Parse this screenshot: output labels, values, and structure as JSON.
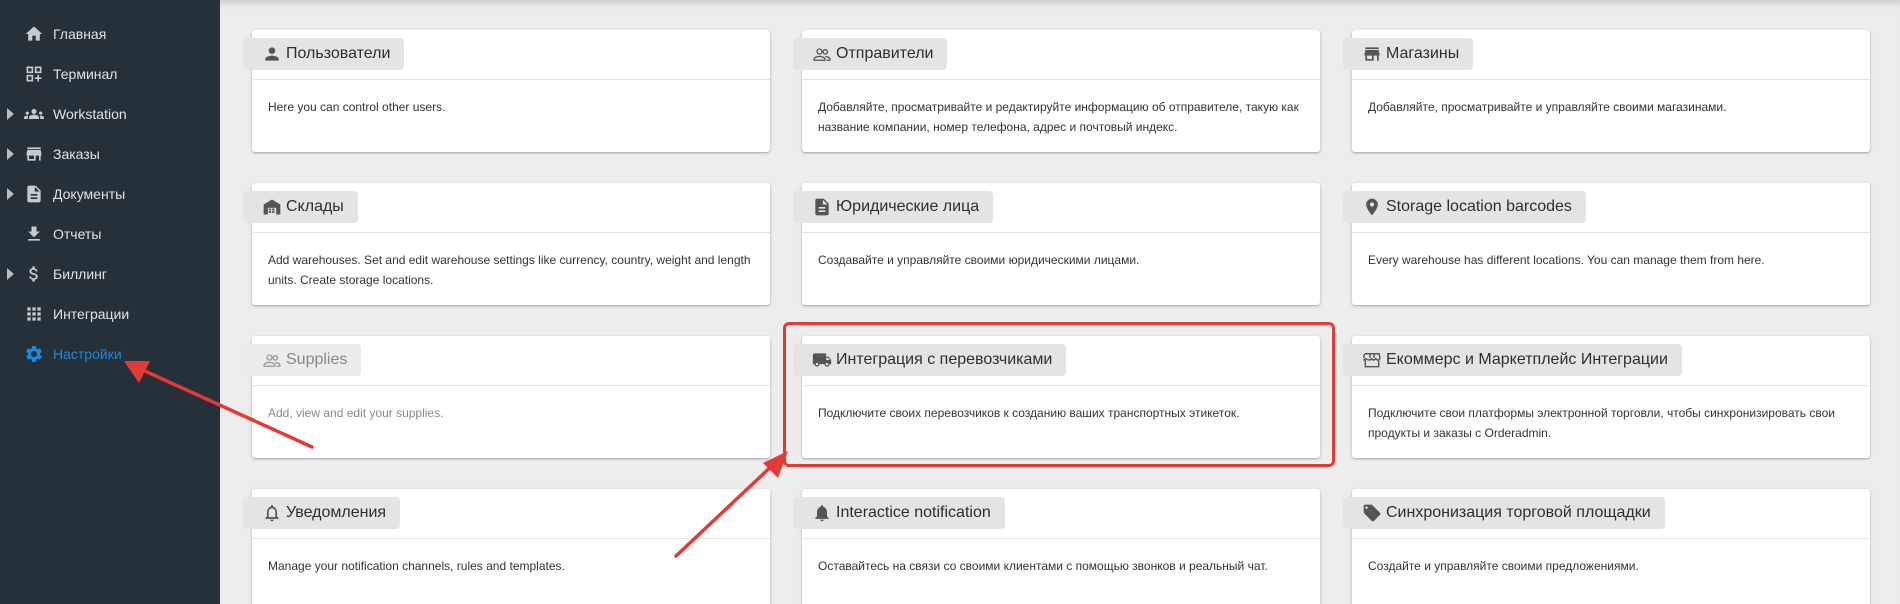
{
  "sidebar": {
    "items": [
      {
        "label": "Главная",
        "icon": "home-icon",
        "has_caret": false,
        "active": false
      },
      {
        "label": "Терминал",
        "icon": "qr-code-icon",
        "has_caret": false,
        "active": false
      },
      {
        "label": "Workstation",
        "icon": "people-icon",
        "has_caret": true,
        "active": false
      },
      {
        "label": "Заказы",
        "icon": "store-icon",
        "has_caret": true,
        "active": false
      },
      {
        "label": "Документы",
        "icon": "document-icon",
        "has_caret": true,
        "active": false
      },
      {
        "label": "Отчеты",
        "icon": "download-icon",
        "has_caret": false,
        "active": false
      },
      {
        "label": "Биллинг",
        "icon": "dollar-icon",
        "has_caret": true,
        "active": false
      },
      {
        "label": "Интеграции",
        "icon": "apps-grid-icon",
        "has_caret": false,
        "active": false
      },
      {
        "label": "Настройки",
        "icon": "gear-icon",
        "has_caret": false,
        "active": true
      }
    ],
    "active_color": "#1e88e5"
  },
  "cards": [
    {
      "title": "Пользователи",
      "icon": "person-icon",
      "description": "Here you can control other users.",
      "disabled": false
    },
    {
      "title": "Отправители",
      "icon": "people-outline-icon",
      "description": "Добавляйте, просматривайте и редактируйте информацию об отправителе, такую как название компании, номер телефона, адрес и почтовый индекс.",
      "disabled": false
    },
    {
      "title": "Магазины",
      "icon": "store-icon",
      "description": "Добавляйте, просматривайте и управляйте своими магазинами.",
      "disabled": false
    },
    {
      "title": "Склады",
      "icon": "warehouse-icon",
      "description": "Add warehouses. Set and edit warehouse settings like currency, country, weight and length units. Create storage locations.",
      "disabled": false
    },
    {
      "title": "Юридические лица",
      "icon": "document-icon",
      "description": "Создавайте и управляйте своими юридическими лицами.",
      "disabled": false
    },
    {
      "title": "Storage location barcodes",
      "icon": "location-pin-icon",
      "description": "Every warehouse has different locations. You can manage them from here.",
      "disabled": false
    },
    {
      "title": "Supplies",
      "icon": "people-outline-icon",
      "description": "Add, view and edit your supplies.",
      "disabled": true
    },
    {
      "title": "Интеграция с перевозчиками",
      "icon": "truck-icon",
      "description": "Подключите своих перевозчиков к созданию ваших транспортных этикеток.",
      "disabled": false
    },
    {
      "title": "Екоммерс и Маркетплейс Интеграции",
      "icon": "storefront-outline-icon",
      "description": "Подключите свои платформы электронной торговли, чтобы синхронизировать свои продукты и заказы с Orderadmin.",
      "disabled": false
    },
    {
      "title": "Уведомления",
      "icon": "bell-outline-icon",
      "description": "Manage your notification channels, rules and templates.",
      "disabled": false
    },
    {
      "title": "Interactice notification",
      "icon": "bell-icon",
      "description": "Оставайтесь на связи со своими клиентами с помощью звонков и реальный чат.",
      "disabled": false
    },
    {
      "title": "Синхронизация торговой площадки",
      "icon": "tag-icon",
      "description": "Создайте и управляйте своими предложениями.",
      "disabled": false
    }
  ],
  "annotations": {
    "highlight_color": "#e53935",
    "highlighted_card": "Интеграция с перевозчиками",
    "arrow_targets": [
      "Настройки",
      "Интеграция с перевозчиками"
    ]
  }
}
